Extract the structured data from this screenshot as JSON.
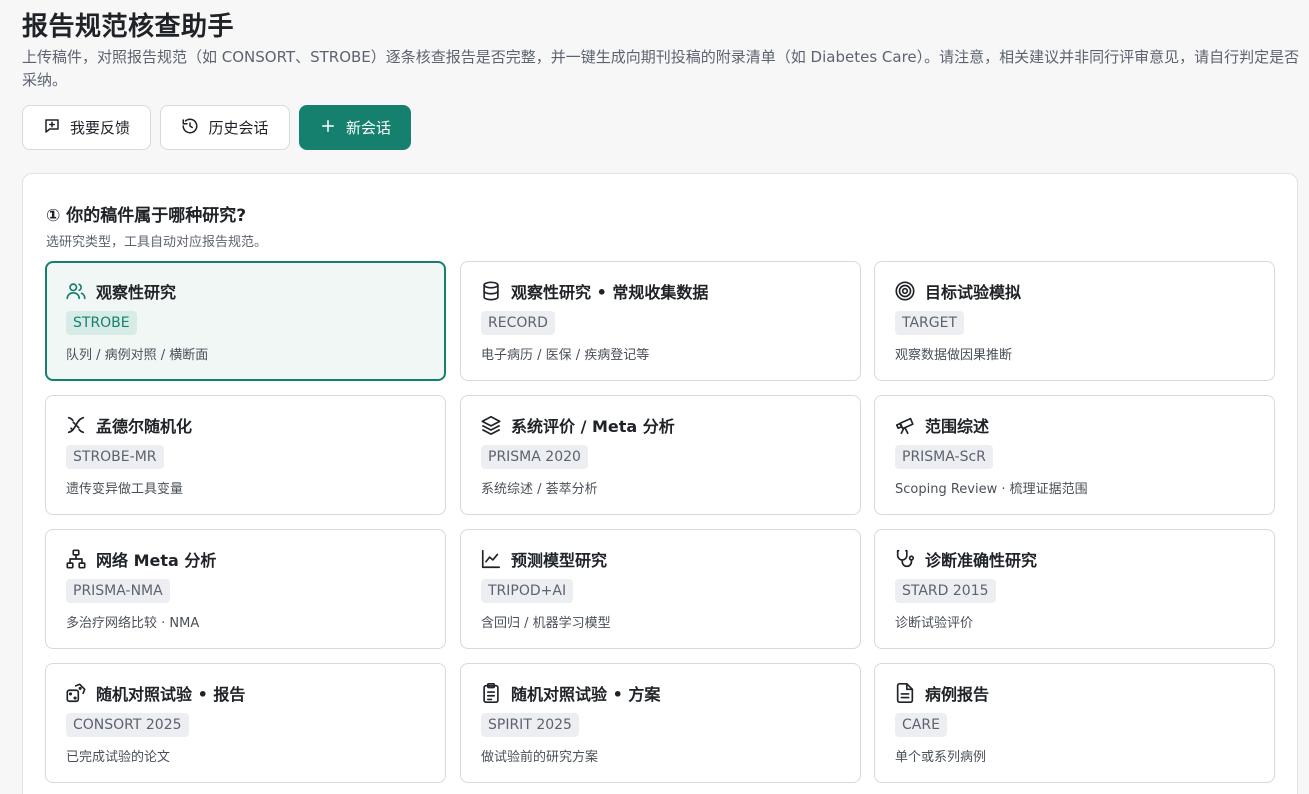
{
  "header": {
    "title": "报告规范核查助手",
    "description": "上传稿件，对照报告规范（如 CONSORT、STROBE）逐条核查报告是否完整，并一键生成向期刊投稿的附录清单（如 Diabetes Care）。请注意，相关建议并非同行评审意见，请自行判定是否采纳。"
  },
  "toolbar": {
    "feedback_label": "我要反馈",
    "history_label": "历史会话",
    "new_session_label": "新会话"
  },
  "section": {
    "title": "① 你的稿件属于哪种研究?",
    "hint": "选研究类型，工具自动对应报告规范。"
  },
  "study_types": [
    {
      "title": "观察性研究",
      "badge": "STROBE",
      "desc": "队列 / 病例对照 / 横断面",
      "icon": "users-icon",
      "selected": true
    },
    {
      "title": "观察性研究 • 常规收集数据",
      "badge": "RECORD",
      "desc": "电子病历 / 医保 / 疾病登记等",
      "icon": "database-icon"
    },
    {
      "title": "目标试验模拟",
      "badge": "TARGET",
      "desc": "观察数据做因果推断",
      "icon": "target-icon"
    },
    {
      "title": "孟德尔随机化",
      "badge": "STROBE-MR",
      "desc": "遗传变异做工具变量",
      "icon": "dna-icon"
    },
    {
      "title": "系统评价 / Meta 分析",
      "badge": "PRISMA 2020",
      "desc": "系统综述 / 荟萃分析",
      "icon": "layers-icon"
    },
    {
      "title": "范围综述",
      "badge": "PRISMA-ScR",
      "desc": "Scoping Review · 梳理证据范围",
      "icon": "telescope-icon"
    },
    {
      "title": "网络 Meta 分析",
      "badge": "PRISMA-NMA",
      "desc": "多治疗网络比较 · NMA",
      "icon": "network-icon"
    },
    {
      "title": "预测模型研究",
      "badge": "TRIPOD+AI",
      "desc": "含回归 / 机器学习模型",
      "icon": "line-chart-icon"
    },
    {
      "title": "诊断准确性研究",
      "badge": "STARD 2015",
      "desc": "诊断试验评价",
      "icon": "stethoscope-icon"
    },
    {
      "title": "随机对照试验 • 报告",
      "badge": "CONSORT 2025",
      "desc": "已完成试验的论文",
      "icon": "dice-icon"
    },
    {
      "title": "随机对照试验 • 方案",
      "badge": "SPIRIT 2025",
      "desc": "做试验前的研究方案",
      "icon": "clipboard-icon"
    },
    {
      "title": "病例报告",
      "badge": "CARE",
      "desc": "单个或系列病例",
      "icon": "file-text-icon"
    }
  ],
  "colors": {
    "accent": "#16806f",
    "selected_bg": "#f1f7f5",
    "badge_bg": "#eceef1"
  }
}
